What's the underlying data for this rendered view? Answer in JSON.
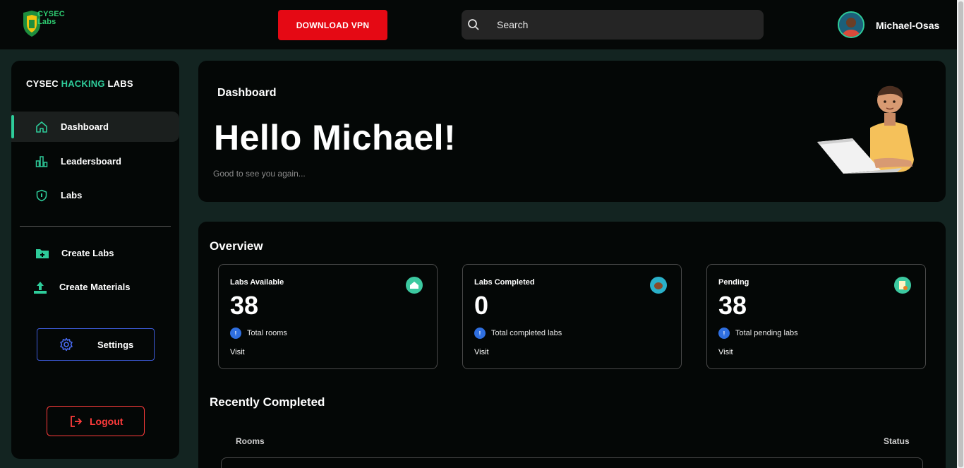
{
  "header": {
    "logo_text": "CYSEC Labs",
    "vpn_label": "DOWNLOAD VPN",
    "search_placeholder": "Search",
    "username": "Michael-Osas"
  },
  "sidebar": {
    "brand_part1": "CYSEC ",
    "brand_part2": "HACKING",
    "brand_part3": " LABS",
    "items": [
      {
        "label": "Dashboard",
        "icon": "home-icon",
        "active": true
      },
      {
        "label": "Leadersboard",
        "icon": "bar-chart-icon"
      },
      {
        "label": "Labs",
        "icon": "shield-icon"
      }
    ],
    "items2": [
      {
        "label": "Create Labs",
        "icon": "folder-plus-icon"
      },
      {
        "label": "Create Materials",
        "icon": "upload-icon"
      }
    ],
    "settings_label": "Settings",
    "logout_label": "Logout"
  },
  "hero": {
    "crumb": "Dashboard",
    "greeting": "Hello Michael!",
    "subtext": "Good to see you again..."
  },
  "overview": {
    "title": "Overview",
    "stats": [
      {
        "title": "Labs Available",
        "value": "38",
        "desc": "Total rooms",
        "visit": "Visit",
        "icon_color": "#3cc9a0"
      },
      {
        "title": "Labs Completed",
        "value": "0",
        "desc": "Total completed labs",
        "visit": "Visit",
        "icon_color": "#2ab0c9"
      },
      {
        "title": "Pending",
        "value": "38",
        "desc": "Total pending labs",
        "visit": "Visit",
        "icon_color": "#3cc9a0"
      }
    ],
    "info_glyph": "!",
    "recent_title": "Recently Completed",
    "columns": [
      "Rooms",
      "Status"
    ]
  },
  "colors": {
    "accent": "#2ecc9a",
    "danger": "#e50914",
    "settings_border": "#3d5bd9"
  }
}
